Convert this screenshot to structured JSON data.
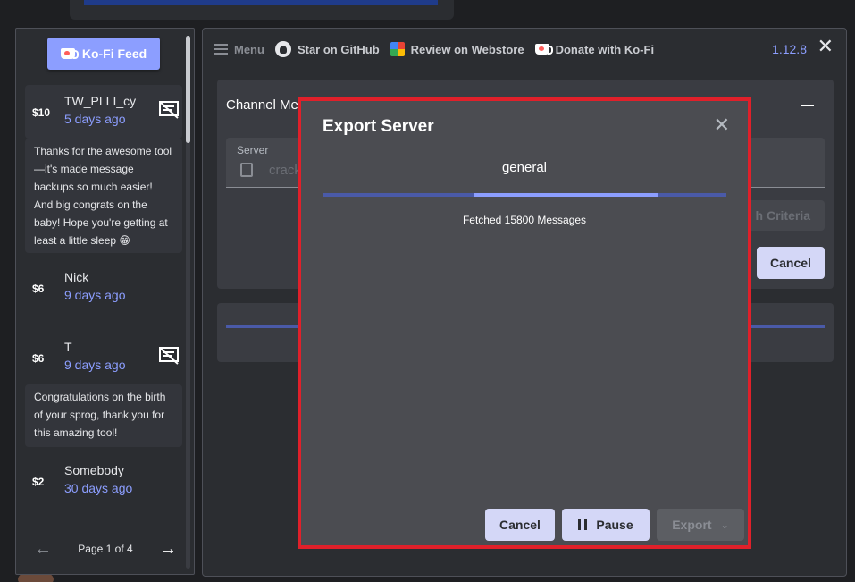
{
  "kofi": {
    "feed_button": "Ko-Fi Feed",
    "donations": [
      {
        "amount": "$10",
        "name": "TW_PLLI_cy",
        "time": "5 days ago",
        "has_message": true,
        "message": "Thanks for the awesome tool—it's made message backups so much easier! And big congrats on the baby! Hope you're getting at least a little sleep 😁"
      },
      {
        "amount": "$6",
        "name": "Nick",
        "time": "9 days ago",
        "has_message": false
      },
      {
        "amount": "$6",
        "name": "T",
        "time": "9 days ago",
        "has_message": true,
        "message": "Congratulations on the birth of your sprog, thank you for this amazing tool!"
      },
      {
        "amount": "$2",
        "name": "Somebody",
        "time": "30 days ago",
        "has_message": false
      }
    ],
    "pager": {
      "label": "Page 1 of 4"
    }
  },
  "toolbar": {
    "menu": "Menu",
    "github": "Star on GitHub",
    "webstore": "Review on Webstore",
    "donate": "Donate with Ko-Fi",
    "version": "1.12.8"
  },
  "background_card": {
    "title": "Channel Me",
    "server_label": "Server",
    "server_value": "crack",
    "criteria_button": "h Criteria",
    "cancel_button": "Cancel"
  },
  "modal": {
    "title": "Export Server",
    "channel": "general",
    "progress_segment": [
      0.375,
      0.83
    ],
    "status": "Fetched 15800 Messages",
    "cancel_button": "Cancel",
    "pause_button": "Pause",
    "export_button": "Export"
  },
  "colors": {
    "accent": "#8c9eff",
    "highlight_border": "#e0202a",
    "panel": "#2b2d31",
    "modal": "#4b4c51"
  }
}
